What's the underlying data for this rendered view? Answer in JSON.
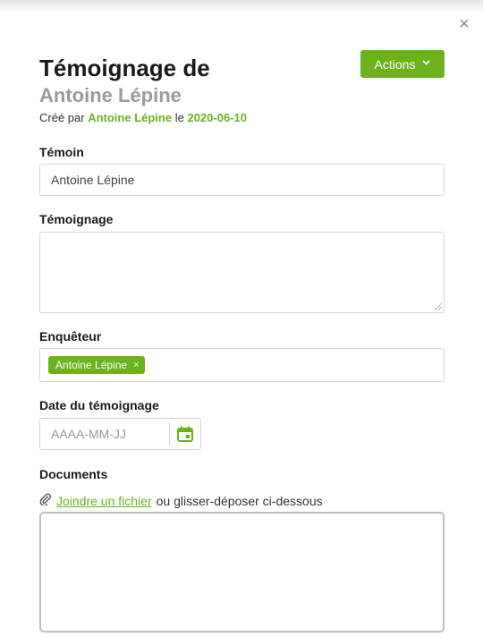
{
  "dialog": {
    "close_icon": "close-icon",
    "close_glyph": "×"
  },
  "header": {
    "title": "Témoignage de",
    "subtitle": "Antoine Lépine",
    "created_prefix": "Créé par",
    "created_by": "Antoine Lépine",
    "created_mid": "le",
    "created_date": "2020-06-10",
    "actions_label": "Actions",
    "actions_icon": "chevron-down-icon"
  },
  "form": {
    "witness": {
      "label": "Témoin",
      "value": "Antoine Lépine"
    },
    "testimony": {
      "label": "Témoignage",
      "value": ""
    },
    "investigator": {
      "label": "Enquêteur",
      "tags": [
        {
          "label": "Antoine Lépine",
          "remove": "×"
        }
      ]
    },
    "date": {
      "label": "Date du témoignage",
      "placeholder": "AAAA-MM-JJ",
      "icon": "calendar-icon"
    },
    "documents": {
      "label": "Documents",
      "attach_icon": "paperclip-icon",
      "attach_link": "Joindre un fichier",
      "attach_suffix": "ou glisser-déposer ci-dessous"
    }
  },
  "colors": {
    "accent": "#6cb31b",
    "muted_title": "#9a9a9a",
    "border": "#d6d6d6"
  }
}
